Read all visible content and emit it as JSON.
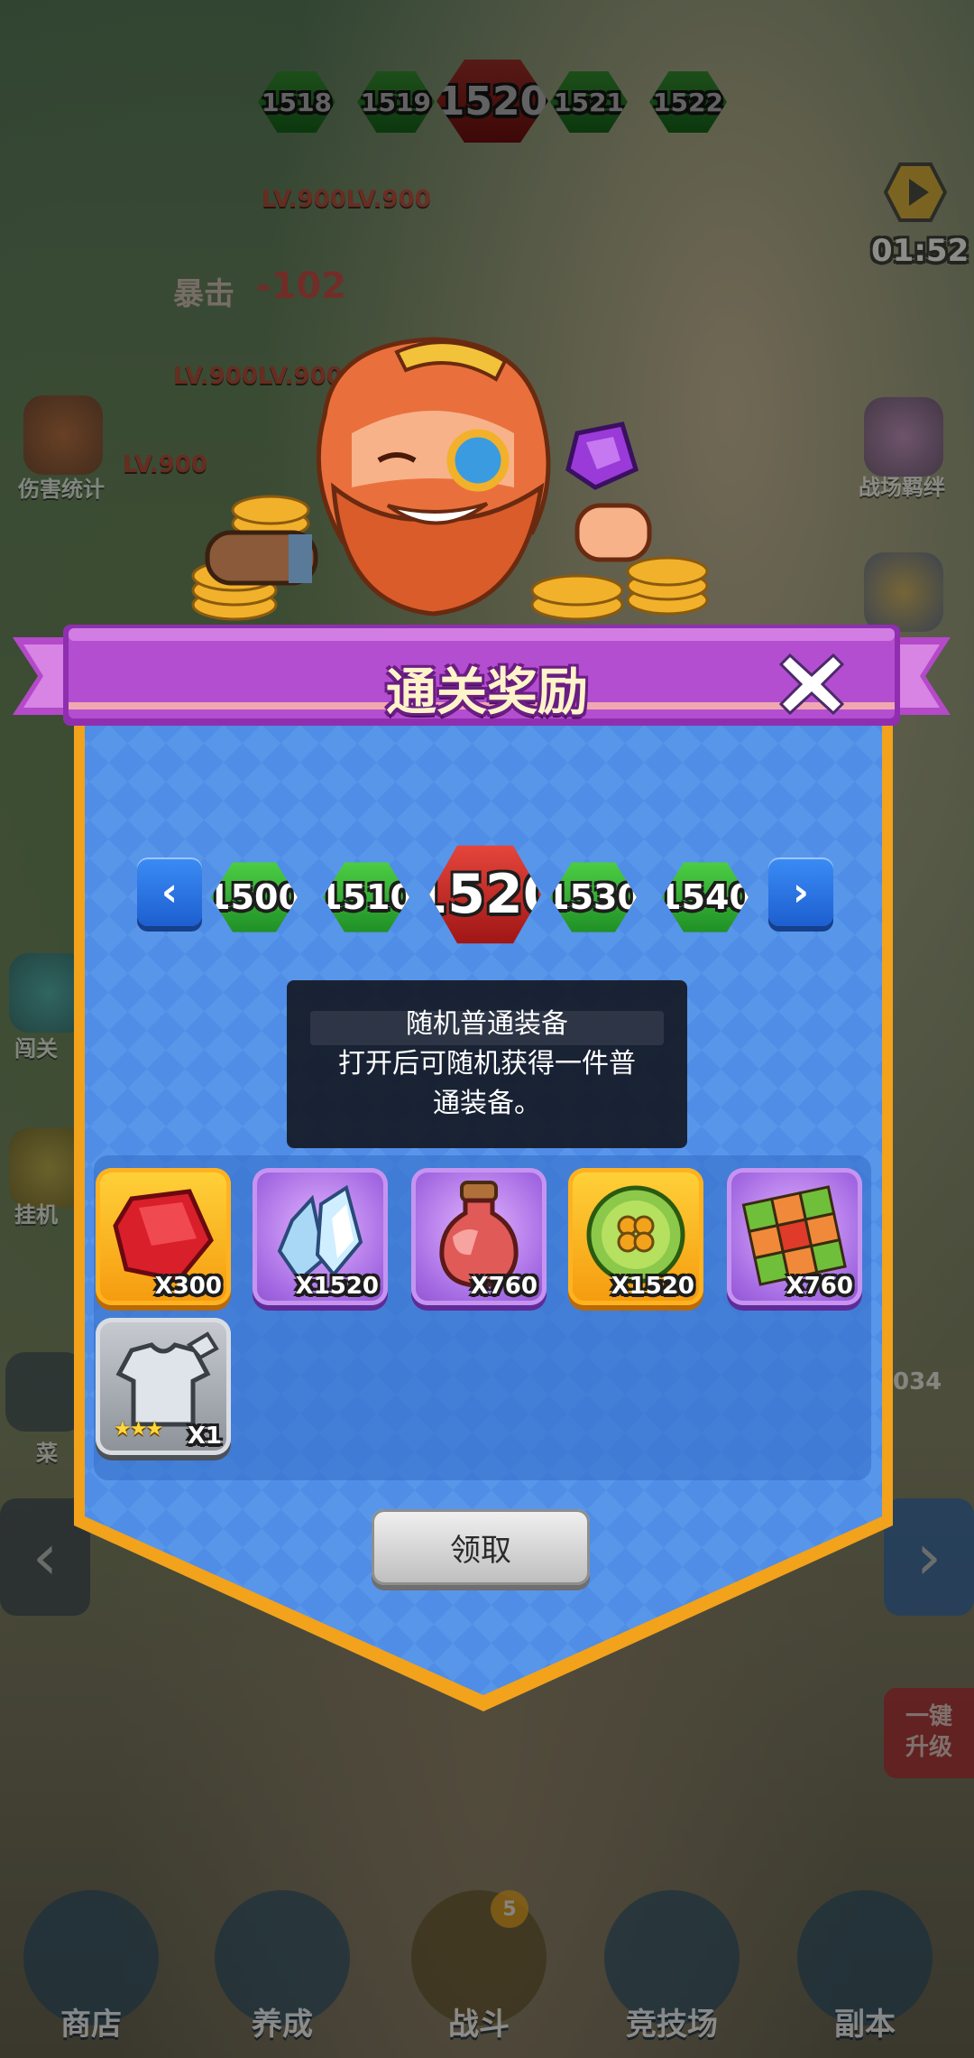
{
  "top_levels": {
    "items": [
      "1518",
      "1519",
      "1520",
      "1521",
      "1522"
    ],
    "current": "1520"
  },
  "background": {
    "lv_labels": [
      "LV.900LV.900",
      "LV.900LV.900",
      "LV.900"
    ],
    "crit_label": "暴击",
    "damage_value": "-102",
    "timer": "01:52",
    "left_side": [
      "伤害统计",
      "闯关",
      "挂机",
      "菜"
    ],
    "right_side": [
      "战场羁绊"
    ],
    "right_counter": "034",
    "upgrade_label": "一键\n升级"
  },
  "bottom_nav": {
    "items": [
      "商店",
      "养成",
      "战斗",
      "竞技场",
      "副本"
    ],
    "battle_badge": "5"
  },
  "dialog": {
    "title": "通关奖励",
    "stages": [
      "1500",
      "1510",
      "1520",
      "1530",
      "1540"
    ],
    "selected_stage": "1520",
    "tooltip": {
      "title": "随机普通装备",
      "description": "打开后可随机获得一件普通装备。",
      "desc_line1": "打开后可随机获得一件普",
      "desc_line2": "通装备。"
    },
    "rewards": [
      {
        "name": "red-gem",
        "quantity": "X300",
        "frame": "gold"
      },
      {
        "name": "crystal",
        "quantity": "X1520",
        "frame": "purple"
      },
      {
        "name": "potion",
        "quantity": "X760",
        "frame": "purple"
      },
      {
        "name": "clover-coin",
        "quantity": "X1520",
        "frame": "gold"
      },
      {
        "name": "tile-block",
        "quantity": "X760",
        "frame": "purple"
      },
      {
        "name": "armor-chest",
        "quantity": "X1",
        "frame": "grey",
        "stars": "★★★"
      }
    ],
    "claim_label": "领取"
  },
  "colors": {
    "panel_blue": "#4f8de6",
    "panel_border": "#f2a21b",
    "banner_purple": "#a844c6",
    "title_text": "#fff4c9"
  }
}
